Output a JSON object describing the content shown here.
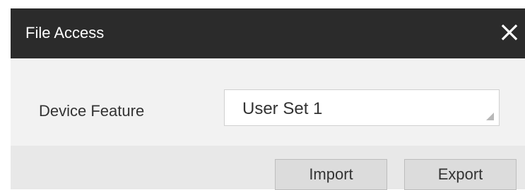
{
  "dialog": {
    "title": "File Access",
    "close_icon": "close-icon"
  },
  "form": {
    "device_feature_label": "Device Feature",
    "device_feature_value": "User Set 1",
    "dropdown_icon": "dropdown-corner-icon"
  },
  "footer": {
    "import_label": "Import",
    "export_label": "Export"
  }
}
